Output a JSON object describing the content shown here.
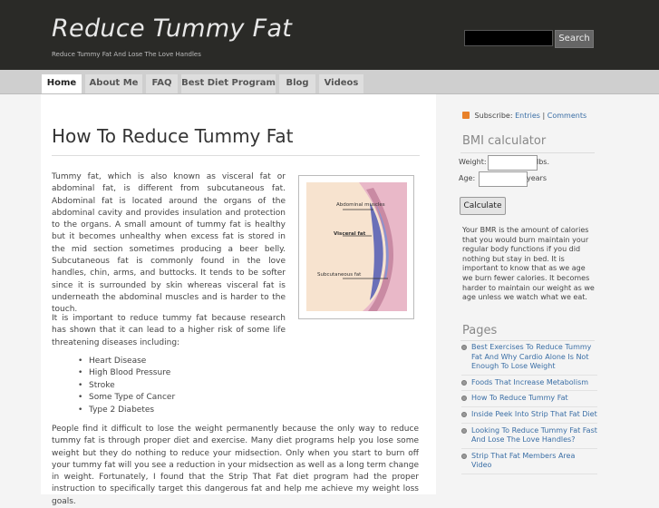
{
  "header": {
    "title": "Reduce Tummy Fat",
    "tagline": "Reduce Tummy Fat And Lose The Love Handles",
    "search_value": "",
    "search_button": "Search"
  },
  "nav": {
    "items": [
      "Home",
      "About Me",
      "FAQ",
      "Best Diet Program",
      "Blog",
      "Videos"
    ],
    "active": "Home"
  },
  "post": {
    "title": "How To Reduce Tummy Fat",
    "paragraph1": "Tummy fat, which is also known as visceral fat or abdominal fat, is different from subcutaneous fat. Abdominal fat is located around the organs of the abdominal cavity and provides insulation and protection to the organs. A small amount of tummy fat is healthy but it becomes unhealthy when excess fat is stored in the mid section sometimes producing a beer belly. Subcutaneous fat is commonly found in the love handles, chin, arms, and buttocks. It tends to be softer since it is surrounded by skin whereas visceral fat is underneath the abdominal muscles and is harder to the touch.",
    "paragraph2": "It is important to reduce tummy fat because research has shown that it can lead to a higher risk of some life threatening diseases including:",
    "list": [
      "Heart Disease",
      "High Blood Pressure",
      "Stroke",
      "Some Type of Cancer",
      "Type 2 Diabetes"
    ],
    "paragraph3": "People find it difficult to lose the weight permanently because the only way to reduce tummy fat is through proper diet and exercise. Many diet programs help you lose some weight but they do nothing to reduce your midsection. Only when you start to burn off your tummy fat will you see a reduction in your midsection as well as a long term change in weight. Fortunately, I found that the Strip That Fat diet program had the proper instruction to specifically target this dangerous fat and help me achieve my weight loss goals.",
    "figure_labels": {
      "abdominal": "Abdominal muscles",
      "visceral": "Visceral fat",
      "subcutaneous": "Subcutaneous fat"
    }
  },
  "sidebar": {
    "subscribe_label": "Subscribe:",
    "subscribe_entries": "Entries",
    "subscribe_sep": "|",
    "subscribe_comments": "Comments",
    "bmi_title": "BMI calculator",
    "weight_label": "Weight:",
    "weight_unit": "lbs.",
    "age_label": "Age:",
    "age_unit": "years",
    "calc_button": "Calculate",
    "bmi_text": "Your BMR is the amount of calories that you would burn maintain your regular body functions if you did nothing but stay in bed. It is important to know that as we age we burn fewer calories. It becomes harder to maintain our weight as we age unless we watch what we eat.",
    "pages_title": "Pages",
    "pages": [
      "Best Exercises To Reduce Tummy Fat And Why Cardio Alone Is Not Enough To Lose Weight",
      "Foods That Increase Metabolism",
      "How To Reduce Tummy Fat",
      "Inside Peek Into Strip That Fat Diet",
      "Looking To Reduce Tummy Fat Fast And Lose The Love Handles?",
      "Strip That Fat Members Area Video"
    ]
  },
  "colors": {
    "header_bg": "#2a2a27",
    "link": "#3a6ea5",
    "rss": "#e8812a"
  }
}
